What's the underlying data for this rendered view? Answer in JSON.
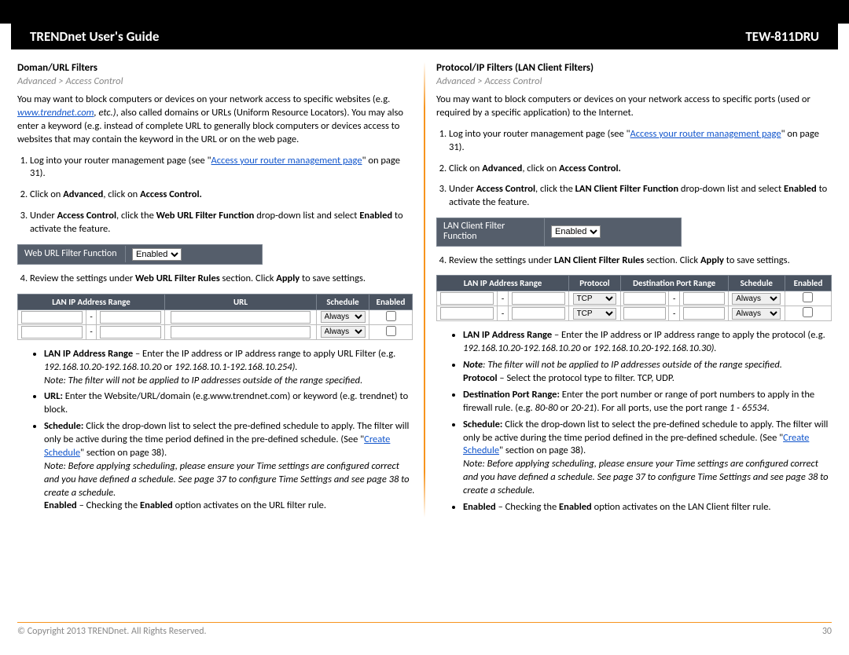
{
  "header": {
    "left": "TRENDnet User's Guide",
    "right": "TEW-811DRU"
  },
  "left": {
    "title": "Doman/URL Filters",
    "breadcrumb": "Advanced > Access Control",
    "intro_a": "You may want to block computers or devices on your network access to specific websites (e.g. ",
    "intro_link": "www.trendnet.com",
    "intro_b": ", etc.)",
    "intro_c": ", also called domains or URLs (Uniform Resource Locators). You may also enter a keyword (e.g. instead of complete URL to generally block computers or devices access to websites that may contain the keyword in the URL or on the web page.",
    "step1a": "Log into your router management page (see \"",
    "step1link": "Access your router management page",
    "step1b": "\" on page 31).",
    "step2a": "Click on ",
    "step2b": "Advanced",
    "step2c": ", click on ",
    "step2d": "Access Control.",
    "step3a": "Under ",
    "step3b": "Access Control",
    "step3c": ", click the ",
    "step3d": "Web URL Filter Function",
    "step3e": " drop-down list and select ",
    "step3f": "Enabled",
    "step3g": " to activate the feature.",
    "uibox_label": "Web URL Filter Function",
    "uibox_value": "Enabled",
    "step4a": "Review the settings under ",
    "step4b": "Web URL Filter Rules",
    "step4c": " section. Click ",
    "step4d": "Apply",
    "step4e": " to save settings.",
    "th1": "LAN IP Address Range",
    "th2": "URL",
    "th3": "Schedule",
    "th4": "Enabled",
    "row_sched": "Always",
    "b1a": "LAN IP Address Range",
    "b1b": " – Enter the IP address or IP address range to apply URL Filter  (e.g. ",
    "b1c": "192.168.10.20-192.168.10.20",
    "b1d": " or ",
    "b1e": "192.168.10.1-192.168.10.254).",
    "b1note": "Note: The filter will not be applied to IP addresses outside of the range specified.",
    "b2a": "URL:",
    "b2b": " Enter the Website/URL/domain (e.g.www.trendnet.com) or keyword (e.g. trendnet) to block.",
    "b3a": "Schedule:",
    "b3b": " Click the drop-down list to select the pre-defined schedule to apply. The filter will only be active during the time period defined in the pre-defined schedule. (See \"",
    "b3link": "Create Schedule",
    "b3c": "\" section on page 38).",
    "b3note": "Note: Before applying scheduling, please ensure your Time settings are configured correct and you have defined a schedule. See page 37 to configure Time Settings and see page 38 to create a schedule.",
    "b4a": "Enabled",
    "b4b": " – Checking the ",
    "b4c": "Enabled",
    "b4d": " option activates on the URL filter rule."
  },
  "right": {
    "title": "Protocol/IP Filters (LAN Client Filters)",
    "breadcrumb": "Advanced > Access Control",
    "intro": "You may want to block computers or devices on your network access to specific ports (used or required by a specific application) to the Internet.",
    "step1a": "Log into your router management page (see \"",
    "step1link": "Access your router management page",
    "step1b": "\" on page 31).",
    "step2a": "Click on ",
    "step2b": "Advanced",
    "step2c": ", click on ",
    "step2d": "Access Control.",
    "step3a": "Under ",
    "step3b": "Access Control",
    "step3c": ", click the ",
    "step3d": "LAN Client Filter Function",
    "step3e": " drop-down list and select ",
    "step3f": "Enabled",
    "step3g": " to activate the feature.",
    "uibox_label": "LAN Client Filter Function",
    "uibox_value": "Enabled",
    "step4a": "Review the settings under ",
    "step4b": "LAN Client Filter Rules",
    "step4c": " section. Click ",
    "step4d": "Apply",
    "step4e": " to save settings.",
    "th1": "LAN IP Address Range",
    "th2": "Protocol",
    "th3": "Destination Port Range",
    "th4": "Schedule",
    "th5": "Enabled",
    "row_proto": "TCP",
    "row_sched": "Always",
    "b1a": "LAN IP Address Range",
    "b1b": " – Enter the IP address or IP address range to apply the protocol (e.g. ",
    "b1c": "192.168.10.20-192.168.10.20",
    "b1d": " or ",
    "b1e": "192.168.10.20-192.168.10.30).",
    "b1note1": "Note",
    "b1note2": ": The filter will not be applied to IP addresses outside of the range specified.",
    "b1proto1": "Protocol",
    "b1proto2": " – Select the protocol type to filter. TCP, UDP.",
    "b2a": "Destination Port Range:",
    "b2b": " Enter the port number or range of port numbers to apply in the firewall rule. (e.g. ",
    "b2c": "80-80 ",
    "b2d": "or ",
    "b2e": "20-21",
    "b2f": "). For all ports, use the port range ",
    "b2g": "1 - 65534",
    "b2h": ".",
    "b3a": "Schedule:",
    "b3b": " Click the drop-down list to select the pre-defined schedule to apply. The filter will only be active during the time period defined in the pre-defined schedule. (See \"",
    "b3link": "Create Schedule",
    "b3c": "\" section on page 38).",
    "b3note": "Note: Before applying scheduling, please ensure your Time settings are configured correct and you have defined a schedule. See page 37 to configure Time Settings and see page 38 to create a schedule.",
    "b4a": "Enabled",
    "b4b": " – Checking the ",
    "b4c": "Enabled",
    "b4d": " option activates on the LAN Client filter rule."
  },
  "footer": {
    "copyright": "© Copyright 2013 TRENDnet. All Rights Reserved.",
    "page": "30"
  }
}
